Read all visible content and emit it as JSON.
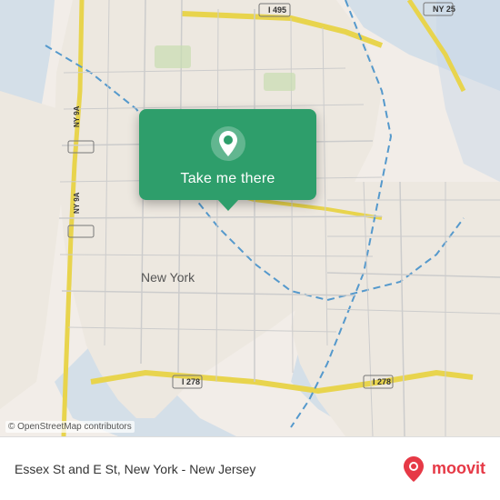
{
  "map": {
    "copyright": "© OpenStreetMap contributors",
    "bg_color": "#e8ddd0"
  },
  "popup": {
    "button_label": "Take me there"
  },
  "footer": {
    "location_text": "Essex St and E St, New York - New Jersey",
    "brand_name": "moovit"
  }
}
